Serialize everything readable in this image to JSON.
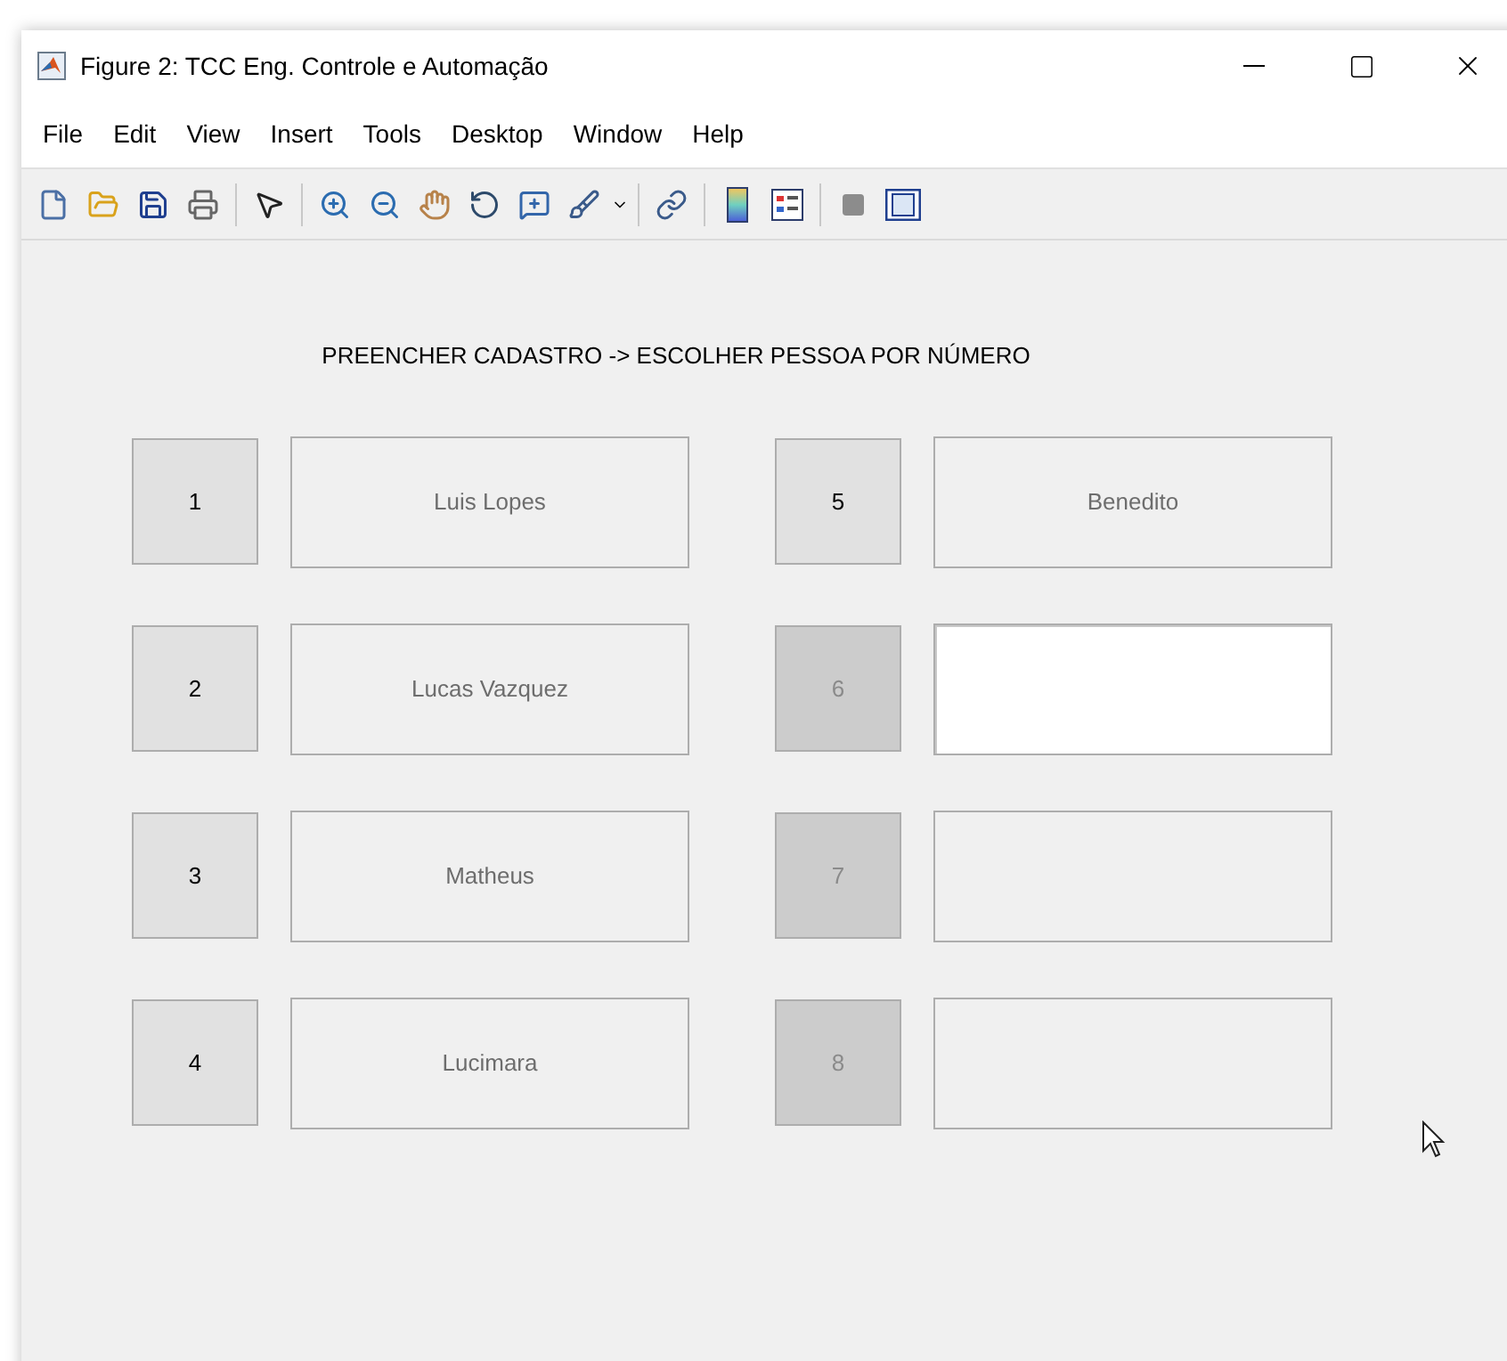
{
  "window": {
    "title": "Figure 2: TCC Eng. Controle e Automação"
  },
  "menu": [
    "File",
    "Edit",
    "View",
    "Insert",
    "Tools",
    "Desktop",
    "Window",
    "Help"
  ],
  "heading": "PREENCHER CADASTRO -> ESCOLHER PESSOA POR NÚMERO",
  "slots": [
    {
      "number": "1",
      "enabled": true,
      "name": "Luis Lopes",
      "editable": false
    },
    {
      "number": "2",
      "enabled": true,
      "name": "Lucas Vazquez",
      "editable": false
    },
    {
      "number": "3",
      "enabled": true,
      "name": "Matheus",
      "editable": false
    },
    {
      "number": "4",
      "enabled": true,
      "name": "Lucimara",
      "editable": false
    },
    {
      "number": "5",
      "enabled": true,
      "name": "Benedito",
      "editable": false
    },
    {
      "number": "6",
      "enabled": false,
      "editable": true
    },
    {
      "number": "7",
      "enabled": false,
      "editable": false
    },
    {
      "number": "8",
      "enabled": false,
      "editable": false
    }
  ]
}
